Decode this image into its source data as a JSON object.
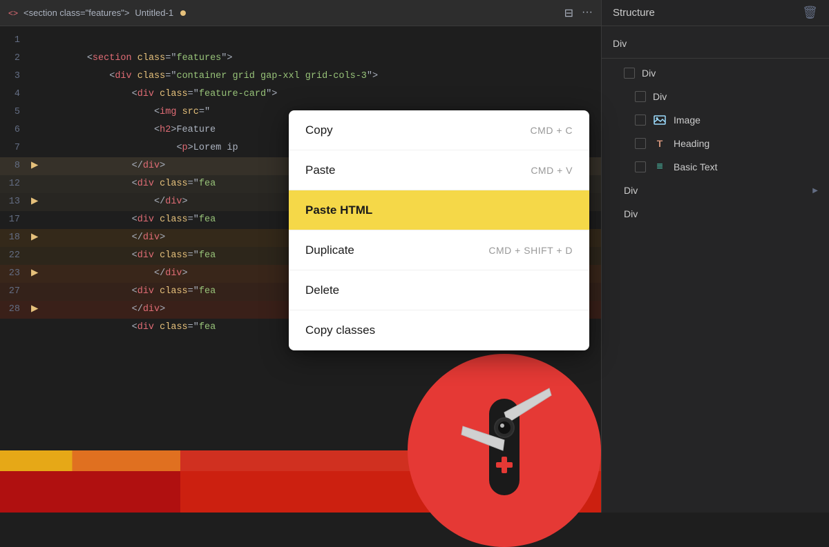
{
  "editor": {
    "title": "<section class=\"features\">",
    "filename": "Untitled-1",
    "modified": true,
    "lines": [
      {
        "num": "1",
        "arrow": "",
        "content": "<section class=\"features\">",
        "indent": 0
      },
      {
        "num": "2",
        "arrow": "",
        "content": "  <div class=\"container grid gap-xxl grid-cols-3\">",
        "indent": 1
      },
      {
        "num": "3",
        "arrow": "",
        "content": "    <div class=\"feature-card\">",
        "indent": 2
      },
      {
        "num": "4",
        "arrow": "",
        "content": "      <img src=\"",
        "indent": 3
      },
      {
        "num": "5",
        "arrow": "",
        "content": "      <h2>Feature",
        "indent": 3
      },
      {
        "num": "6",
        "arrow": "",
        "content": "        <p>Lorem ip",
        "indent": 4
      },
      {
        "num": "7",
        "arrow": "",
        "content": "    </div>",
        "indent": 2
      },
      {
        "num": "8",
        "arrow": ">",
        "content": "    <div class=\"fea",
        "indent": 2
      },
      {
        "num": "12",
        "arrow": "",
        "content": "      </div>",
        "indent": 3
      },
      {
        "num": "13",
        "arrow": ">",
        "content": "    <div class=\"fea",
        "indent": 2
      },
      {
        "num": "17",
        "arrow": "",
        "content": "    </div>",
        "indent": 2
      },
      {
        "num": "18",
        "arrow": ">",
        "content": "    <div class=\"fea",
        "indent": 2
      },
      {
        "num": "22",
        "arrow": "",
        "content": "      </div>",
        "indent": 3
      },
      {
        "num": "23",
        "arrow": ">",
        "content": "    <div class=\"fea",
        "indent": 2
      },
      {
        "num": "27",
        "arrow": "",
        "content": "    </div>",
        "indent": 2
      },
      {
        "num": "28",
        "arrow": ">",
        "content": "    <div class=\"fea",
        "indent": 2
      }
    ]
  },
  "right_panel": {
    "title": "Structure",
    "items": [
      {
        "type": "div",
        "label": "Div",
        "indent": 0,
        "has_checkbox": false,
        "has_arrow": false
      },
      {
        "type": "div",
        "label": "Div",
        "indent": 1,
        "has_checkbox": true,
        "has_arrow": false
      },
      {
        "type": "div",
        "label": "Div",
        "indent": 2,
        "has_checkbox": true,
        "has_arrow": false
      },
      {
        "type": "image",
        "label": "Image",
        "indent": 2,
        "has_checkbox": true,
        "has_arrow": false
      },
      {
        "type": "heading",
        "label": "Heading",
        "indent": 2,
        "has_checkbox": true,
        "has_arrow": false
      },
      {
        "type": "text",
        "label": "Basic Text",
        "indent": 2,
        "has_checkbox": true,
        "has_arrow": false
      },
      {
        "type": "div",
        "label": "Div",
        "indent": 1,
        "has_checkbox": false,
        "has_arrow": true
      },
      {
        "type": "div",
        "label": "Div",
        "indent": 1,
        "has_checkbox": false,
        "has_arrow": false
      }
    ]
  },
  "context_menu": {
    "items": [
      {
        "label": "Copy",
        "shortcut": "CMD + C",
        "highlighted": false
      },
      {
        "label": "Paste",
        "shortcut": "CMD + V",
        "highlighted": false
      },
      {
        "label": "Paste HTML",
        "shortcut": "",
        "highlighted": true
      },
      {
        "label": "Duplicate",
        "shortcut": "CMD + SHIFT + D",
        "highlighted": false
      },
      {
        "label": "Delete",
        "shortcut": "",
        "highlighted": false
      },
      {
        "label": "Copy classes",
        "shortcut": "",
        "highlighted": false
      }
    ]
  }
}
